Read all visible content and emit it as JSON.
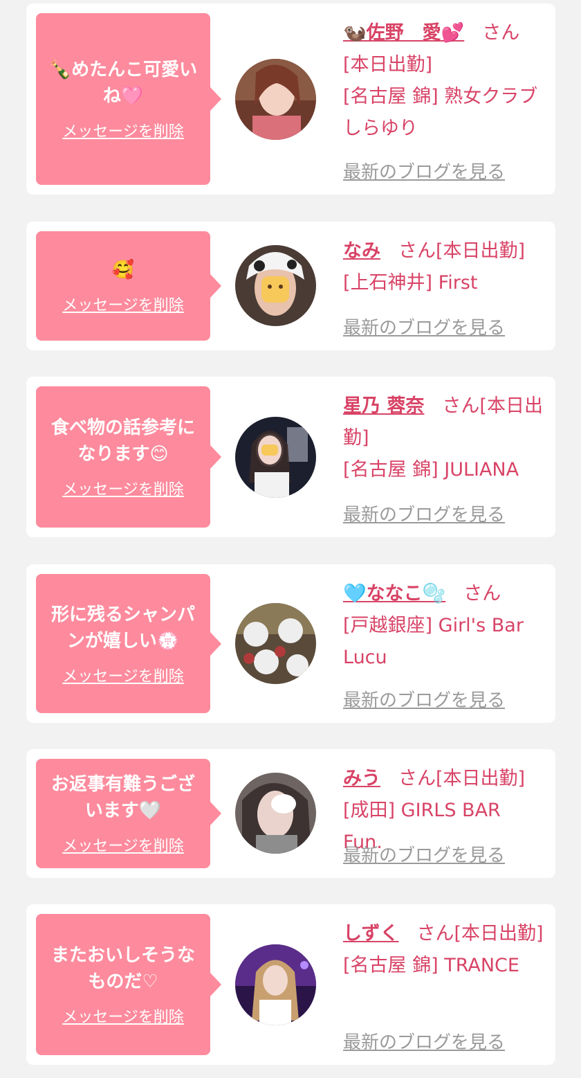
{
  "cards": [
    {
      "message": "🍾めたんこ可愛いね🩷",
      "delete_label": "メッセージを削除",
      "name": "🦦佐野　愛💕",
      "san": "さん",
      "status": "[本日出勤]",
      "shop": "[名古屋 錦] 熟女クラブしらゆり",
      "blog_label": "最新のブログを見る"
    },
    {
      "message": "🥰",
      "delete_label": "メッセージを削除",
      "name": "なみ",
      "san": "さん",
      "status": "[本日出勤]",
      "shop": "[上石神井] First",
      "blog_label": "最新のブログを見る"
    },
    {
      "message": "食べ物の話参考になります😊",
      "delete_label": "メッセージを削除",
      "name": "星乃 蓉奈",
      "san": "さん",
      "status": "[本日出勤]",
      "shop": "[名古屋 錦] JULIANA",
      "blog_label": "最新のブログを見る"
    },
    {
      "message": "形に残るシャンパンが嬉しい💮",
      "delete_label": "メッセージを削除",
      "name": "🩵ななこ🫧",
      "san": "さん",
      "status": "",
      "shop": "[戸越銀座] Girl's Bar Lucu",
      "blog_label": "最新のブログを見る"
    },
    {
      "message": "お返事有難うございます🤍",
      "delete_label": "メッセージを削除",
      "name": "みう",
      "san": "さん",
      "status": "[本日出勤]",
      "shop": "[成田] GIRLS BAR Fun.",
      "blog_label": "最新のブログを見る"
    },
    {
      "message": "またおいしそうなものだ♡",
      "delete_label": "メッセージを削除",
      "name": "しずく",
      "san": "さん",
      "status": "[本日出勤]",
      "shop": "[名古屋 錦] TRANCE",
      "blog_label": "最新のブログを見る"
    }
  ]
}
